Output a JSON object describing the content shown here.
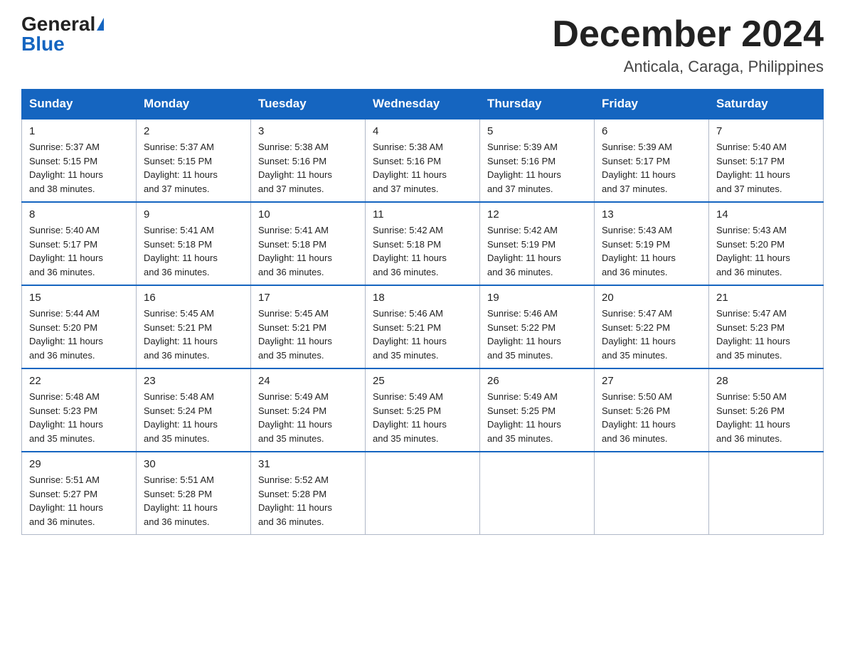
{
  "header": {
    "logo_general": "General",
    "logo_blue": "Blue",
    "title": "December 2024",
    "location": "Anticala, Caraga, Philippines"
  },
  "weekdays": [
    "Sunday",
    "Monday",
    "Tuesday",
    "Wednesday",
    "Thursday",
    "Friday",
    "Saturday"
  ],
  "weeks": [
    [
      {
        "day": "1",
        "sunrise": "5:37 AM",
        "sunset": "5:15 PM",
        "daylight": "11 hours and 38 minutes."
      },
      {
        "day": "2",
        "sunrise": "5:37 AM",
        "sunset": "5:15 PM",
        "daylight": "11 hours and 37 minutes."
      },
      {
        "day": "3",
        "sunrise": "5:38 AM",
        "sunset": "5:16 PM",
        "daylight": "11 hours and 37 minutes."
      },
      {
        "day": "4",
        "sunrise": "5:38 AM",
        "sunset": "5:16 PM",
        "daylight": "11 hours and 37 minutes."
      },
      {
        "day": "5",
        "sunrise": "5:39 AM",
        "sunset": "5:16 PM",
        "daylight": "11 hours and 37 minutes."
      },
      {
        "day": "6",
        "sunrise": "5:39 AM",
        "sunset": "5:17 PM",
        "daylight": "11 hours and 37 minutes."
      },
      {
        "day": "7",
        "sunrise": "5:40 AM",
        "sunset": "5:17 PM",
        "daylight": "11 hours and 37 minutes."
      }
    ],
    [
      {
        "day": "8",
        "sunrise": "5:40 AM",
        "sunset": "5:17 PM",
        "daylight": "11 hours and 36 minutes."
      },
      {
        "day": "9",
        "sunrise": "5:41 AM",
        "sunset": "5:18 PM",
        "daylight": "11 hours and 36 minutes."
      },
      {
        "day": "10",
        "sunrise": "5:41 AM",
        "sunset": "5:18 PM",
        "daylight": "11 hours and 36 minutes."
      },
      {
        "day": "11",
        "sunrise": "5:42 AM",
        "sunset": "5:18 PM",
        "daylight": "11 hours and 36 minutes."
      },
      {
        "day": "12",
        "sunrise": "5:42 AM",
        "sunset": "5:19 PM",
        "daylight": "11 hours and 36 minutes."
      },
      {
        "day": "13",
        "sunrise": "5:43 AM",
        "sunset": "5:19 PM",
        "daylight": "11 hours and 36 minutes."
      },
      {
        "day": "14",
        "sunrise": "5:43 AM",
        "sunset": "5:20 PM",
        "daylight": "11 hours and 36 minutes."
      }
    ],
    [
      {
        "day": "15",
        "sunrise": "5:44 AM",
        "sunset": "5:20 PM",
        "daylight": "11 hours and 36 minutes."
      },
      {
        "day": "16",
        "sunrise": "5:45 AM",
        "sunset": "5:21 PM",
        "daylight": "11 hours and 36 minutes."
      },
      {
        "day": "17",
        "sunrise": "5:45 AM",
        "sunset": "5:21 PM",
        "daylight": "11 hours and 35 minutes."
      },
      {
        "day": "18",
        "sunrise": "5:46 AM",
        "sunset": "5:21 PM",
        "daylight": "11 hours and 35 minutes."
      },
      {
        "day": "19",
        "sunrise": "5:46 AM",
        "sunset": "5:22 PM",
        "daylight": "11 hours and 35 minutes."
      },
      {
        "day": "20",
        "sunrise": "5:47 AM",
        "sunset": "5:22 PM",
        "daylight": "11 hours and 35 minutes."
      },
      {
        "day": "21",
        "sunrise": "5:47 AM",
        "sunset": "5:23 PM",
        "daylight": "11 hours and 35 minutes."
      }
    ],
    [
      {
        "day": "22",
        "sunrise": "5:48 AM",
        "sunset": "5:23 PM",
        "daylight": "11 hours and 35 minutes."
      },
      {
        "day": "23",
        "sunrise": "5:48 AM",
        "sunset": "5:24 PM",
        "daylight": "11 hours and 35 minutes."
      },
      {
        "day": "24",
        "sunrise": "5:49 AM",
        "sunset": "5:24 PM",
        "daylight": "11 hours and 35 minutes."
      },
      {
        "day": "25",
        "sunrise": "5:49 AM",
        "sunset": "5:25 PM",
        "daylight": "11 hours and 35 minutes."
      },
      {
        "day": "26",
        "sunrise": "5:49 AM",
        "sunset": "5:25 PM",
        "daylight": "11 hours and 35 minutes."
      },
      {
        "day": "27",
        "sunrise": "5:50 AM",
        "sunset": "5:26 PM",
        "daylight": "11 hours and 36 minutes."
      },
      {
        "day": "28",
        "sunrise": "5:50 AM",
        "sunset": "5:26 PM",
        "daylight": "11 hours and 36 minutes."
      }
    ],
    [
      {
        "day": "29",
        "sunrise": "5:51 AM",
        "sunset": "5:27 PM",
        "daylight": "11 hours and 36 minutes."
      },
      {
        "day": "30",
        "sunrise": "5:51 AM",
        "sunset": "5:28 PM",
        "daylight": "11 hours and 36 minutes."
      },
      {
        "day": "31",
        "sunrise": "5:52 AM",
        "sunset": "5:28 PM",
        "daylight": "11 hours and 36 minutes."
      },
      null,
      null,
      null,
      null
    ]
  ],
  "labels": {
    "sunrise": "Sunrise:",
    "sunset": "Sunset:",
    "daylight": "Daylight:"
  }
}
